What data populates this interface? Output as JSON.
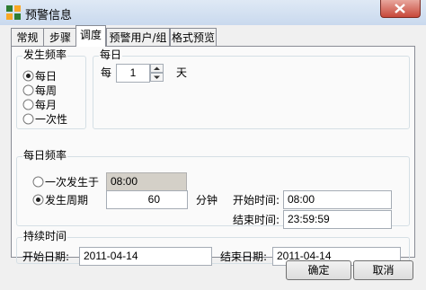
{
  "window": {
    "title": "预警信息"
  },
  "tabs": [
    {
      "label": "常规"
    },
    {
      "label": "步骤"
    },
    {
      "label": "调度"
    },
    {
      "label": "预警用户/组"
    },
    {
      "label": "格式预览"
    }
  ],
  "active_tab": "调度",
  "frequency": {
    "legend": "发生频率",
    "options": [
      "每日",
      "每周",
      "每月",
      "一次性"
    ],
    "selected": "每日"
  },
  "daily": {
    "legend": "每日",
    "prefix": "每",
    "value": "1",
    "suffix": "天"
  },
  "daily_frequency": {
    "legend": "每日频率",
    "once_label": "一次发生于",
    "once_time": "08:00",
    "periodic_label": "发生周期",
    "periodic_value": "60",
    "periodic_unit": "分钟",
    "selected": "发生周期",
    "start_label": "开始时间:",
    "start_value": "08:00",
    "end_label": "结束时间:",
    "end_value": "23:59:59"
  },
  "duration": {
    "legend": "持续时间",
    "start_label": "开始日期:",
    "start_value": "2011-04-14",
    "end_label": "结束日期:",
    "end_value": "2011-04-14"
  },
  "buttons": {
    "ok": "确定",
    "cancel": "取消"
  },
  "icons": {
    "app": "app-grid-icon",
    "close": "close-icon"
  }
}
